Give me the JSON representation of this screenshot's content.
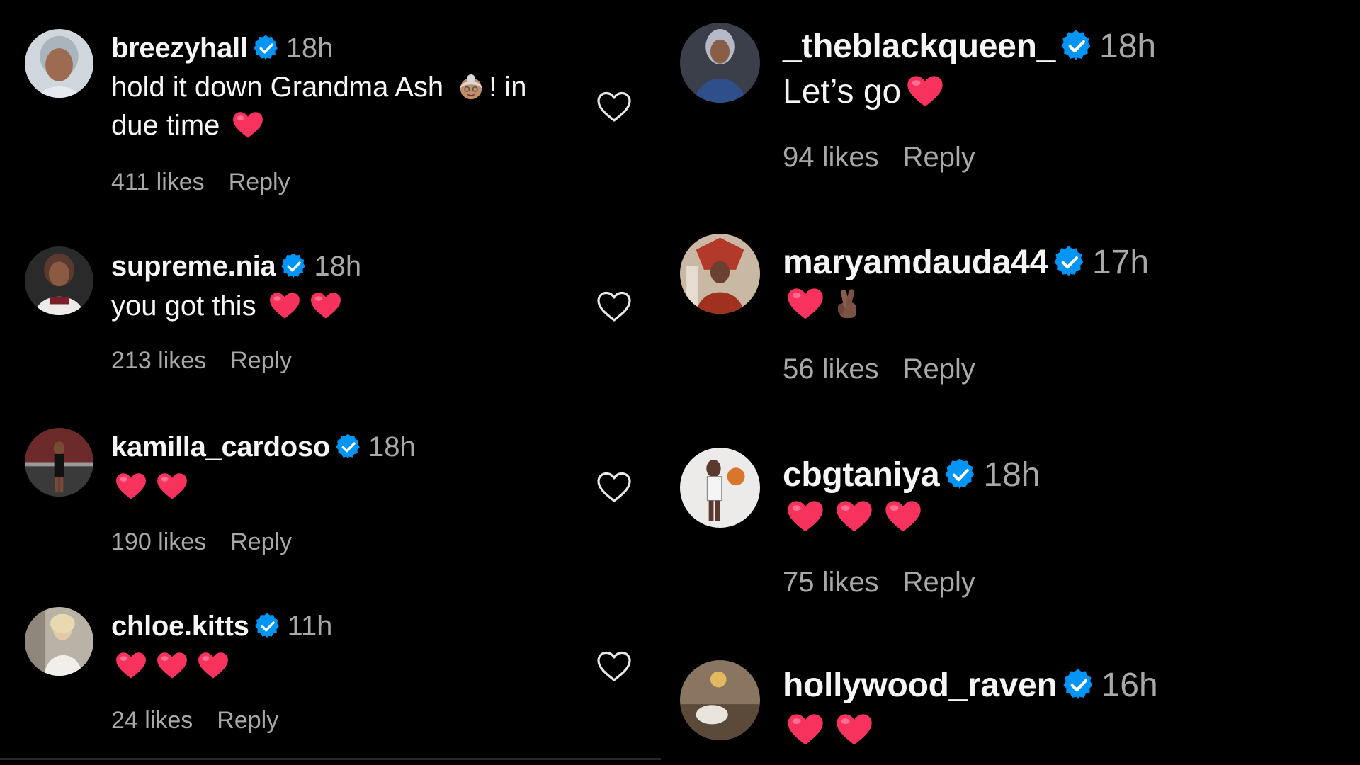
{
  "colors": {
    "background": "#000000",
    "text_primary": "#f5f5f5",
    "text_secondary": "#a8a8a8",
    "verified_badge": "#0095f6",
    "heart_emoji": "#f7325c"
  },
  "icons": {
    "verified": "verified-badge-icon",
    "like": "heart-outline-icon",
    "heart_emoji": "pink-heart-emoji",
    "grandma_emoji": "old-woman-emoji",
    "crossed_fingers_emoji": "crossed-fingers-emoji"
  },
  "left_column": {
    "comments": [
      {
        "username": "breezyhall",
        "time": "18h",
        "line1_prefix": "hold it down Grandma Ash",
        "line1_suffix": "! in",
        "line2": "due time",
        "likes": "411 likes",
        "reply": "Reply"
      },
      {
        "username": "supreme.nia",
        "time": "18h",
        "text": "you got this",
        "likes": "213 likes",
        "reply": "Reply"
      },
      {
        "username": "kamilla_cardoso",
        "time": "18h",
        "likes": "190 likes",
        "reply": "Reply"
      },
      {
        "username": "chloe.kitts",
        "time": "11h",
        "likes": "24 likes",
        "reply": "Reply"
      }
    ]
  },
  "right_column": {
    "comments": [
      {
        "username": "_theblackqueen_",
        "time": "18h",
        "text": "Let’s go",
        "likes": "94 likes",
        "reply": "Reply"
      },
      {
        "username": "maryamdauda44",
        "time": "17h",
        "likes": "56 likes",
        "reply": "Reply"
      },
      {
        "username": "cbgtaniya",
        "time": "18h",
        "likes": "75 likes",
        "reply": "Reply"
      },
      {
        "username": "hollywood_raven",
        "time": "16h"
      }
    ]
  }
}
